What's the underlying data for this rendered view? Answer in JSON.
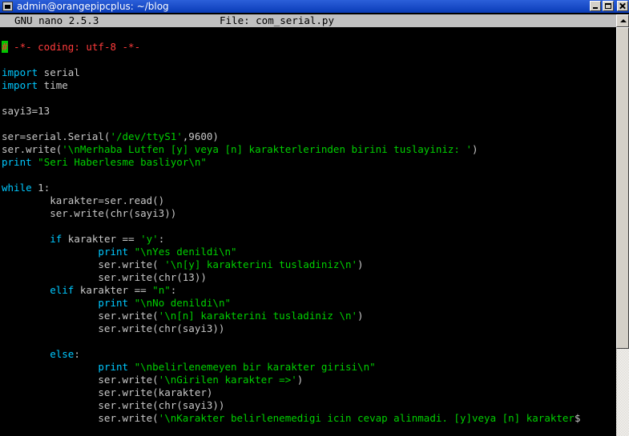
{
  "window": {
    "title": "admin@orangepipcplus: ~/blog"
  },
  "nano": {
    "version": "GNU nano 2.5.3",
    "file_label": "File: com_serial.py"
  },
  "code": [
    [
      {
        "t": "#",
        "c": "cursor"
      },
      {
        "t": " -*- coding: utf-8 -*-",
        "c": "c-comment"
      }
    ],
    [],
    [
      {
        "t": "import",
        "c": "c-kw"
      },
      {
        "t": " serial"
      }
    ],
    [
      {
        "t": "import",
        "c": "c-kw"
      },
      {
        "t": " time"
      }
    ],
    [],
    [
      {
        "t": "sayi3=13"
      }
    ],
    [],
    [
      {
        "t": "ser=serial.Serial("
      },
      {
        "t": "'/dev/ttyS1'",
        "c": "c-str"
      },
      {
        "t": ",9600)"
      }
    ],
    [
      {
        "t": "ser.write("
      },
      {
        "t": "'\\nMerhaba Lutfen [y] veya [n] karakterlerinden birini tuslayiniz: '",
        "c": "c-str"
      },
      {
        "t": ")"
      }
    ],
    [
      {
        "t": "print",
        "c": "c-kw"
      },
      {
        "t": " "
      },
      {
        "t": "\"Seri Haberlesme basliyor\\n\"",
        "c": "c-str"
      }
    ],
    [],
    [
      {
        "t": "while",
        "c": "c-kw"
      },
      {
        "t": " 1:"
      }
    ],
    [
      {
        "t": "        karakter=ser.read()"
      }
    ],
    [
      {
        "t": "        ser.write(chr(sayi3))"
      }
    ],
    [],
    [
      {
        "t": "        "
      },
      {
        "t": "if",
        "c": "c-kw"
      },
      {
        "t": " karakter == "
      },
      {
        "t": "'y'",
        "c": "c-str"
      },
      {
        "t": ":"
      }
    ],
    [
      {
        "t": "                "
      },
      {
        "t": "print",
        "c": "c-kw"
      },
      {
        "t": " "
      },
      {
        "t": "\"\\nYes denildi\\n\"",
        "c": "c-str"
      }
    ],
    [
      {
        "t": "                ser.write( "
      },
      {
        "t": "'\\n[y] karakterini tusladiniz\\n'",
        "c": "c-str"
      },
      {
        "t": ")"
      }
    ],
    [
      {
        "t": "                ser.write(chr(13))"
      }
    ],
    [
      {
        "t": "        "
      },
      {
        "t": "elif",
        "c": "c-kw"
      },
      {
        "t": " karakter == "
      },
      {
        "t": "\"n\"",
        "c": "c-str"
      },
      {
        "t": ":"
      }
    ],
    [
      {
        "t": "                "
      },
      {
        "t": "print",
        "c": "c-kw"
      },
      {
        "t": " "
      },
      {
        "t": "\"\\nNo denildi\\n\"",
        "c": "c-str"
      }
    ],
    [
      {
        "t": "                ser.write("
      },
      {
        "t": "'\\n[n] karakterini tusladiniz \\n'",
        "c": "c-str"
      },
      {
        "t": ")"
      }
    ],
    [
      {
        "t": "                ser.write(chr(sayi3))"
      }
    ],
    [],
    [
      {
        "t": "        "
      },
      {
        "t": "else",
        "c": "c-kw"
      },
      {
        "t": ":"
      }
    ],
    [
      {
        "t": "                "
      },
      {
        "t": "print",
        "c": "c-kw"
      },
      {
        "t": " "
      },
      {
        "t": "\"\\nbelirlenemeyen bir karakter girisi\\n\"",
        "c": "c-str"
      }
    ],
    [
      {
        "t": "                ser.write("
      },
      {
        "t": "'\\nGirilen karakter =>'",
        "c": "c-str"
      },
      {
        "t": ")"
      }
    ],
    [
      {
        "t": "                ser.write(karakter)"
      }
    ],
    [
      {
        "t": "                ser.write(chr(sayi3))"
      }
    ],
    [
      {
        "t": "                ser.write("
      },
      {
        "t": "'\\nKarakter belirlenemedigi icin cevap alinmadi. [y]veya [n] karakter",
        "c": "c-str"
      },
      {
        "t": "$",
        "c": "c-dollar"
      }
    ]
  ]
}
